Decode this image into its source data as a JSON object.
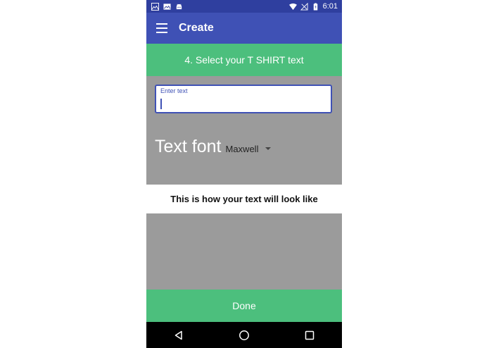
{
  "status_bar": {
    "time": "6:01",
    "left_icons": [
      "image-icon",
      "gallery-icon",
      "android-icon"
    ],
    "right_icons": [
      "wifi-icon",
      "no-signal-icon",
      "battery-icon"
    ]
  },
  "app_bar": {
    "menu_icon": "menu-icon",
    "title": "Create"
  },
  "step": {
    "label": "4. Select your T SHIRT text"
  },
  "text_input": {
    "label": "Enter text",
    "value": "",
    "placeholder": ""
  },
  "font": {
    "label": "Text font",
    "selected": "Maxwell"
  },
  "preview": {
    "text": "This is how your text will look like"
  },
  "done_button": {
    "label": "Done"
  },
  "nav_bar": {
    "buttons": [
      "back-icon",
      "home-icon",
      "recents-icon"
    ]
  },
  "colors": {
    "status_bar": "#2f3f9f",
    "app_bar": "#3f51b5",
    "accent_green": "#4cbf7d",
    "content_gray": "#9b9b9b"
  }
}
